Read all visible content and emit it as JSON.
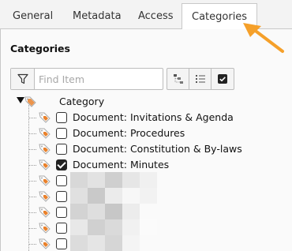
{
  "tabs": [
    {
      "label": "General",
      "active": false
    },
    {
      "label": "Metadata",
      "active": false
    },
    {
      "label": "Access",
      "active": false
    },
    {
      "label": "Categories",
      "active": true
    }
  ],
  "section": {
    "title": "Categories"
  },
  "filter": {
    "placeholder": "Find Item",
    "value": ""
  },
  "toolbar": {
    "icons": [
      "filter-icon",
      "expand-tree-icon",
      "list-icon",
      "check-all-icon"
    ]
  },
  "tree": {
    "root": {
      "label": "Category",
      "expanded": true
    },
    "items": [
      {
        "label": "Document: Invitations & Agenda",
        "checked": false
      },
      {
        "label": "Document: Procedures",
        "checked": false
      },
      {
        "label": "Document: Constitution & By-laws",
        "checked": false
      },
      {
        "label": "Document: Minutes",
        "checked": true
      },
      {
        "label": "",
        "checked": false,
        "redacted": true
      },
      {
        "label": "",
        "checked": false,
        "redacted": true
      },
      {
        "label": "",
        "checked": false,
        "redacted": true
      },
      {
        "label": "",
        "checked": false,
        "redacted": true
      },
      {
        "label": "",
        "checked": false,
        "redacted": true
      }
    ]
  },
  "colors": {
    "accent_arrow": "#f5a02a",
    "tag_orange": "#e9812b",
    "tag_gray": "#a9a9a9"
  }
}
